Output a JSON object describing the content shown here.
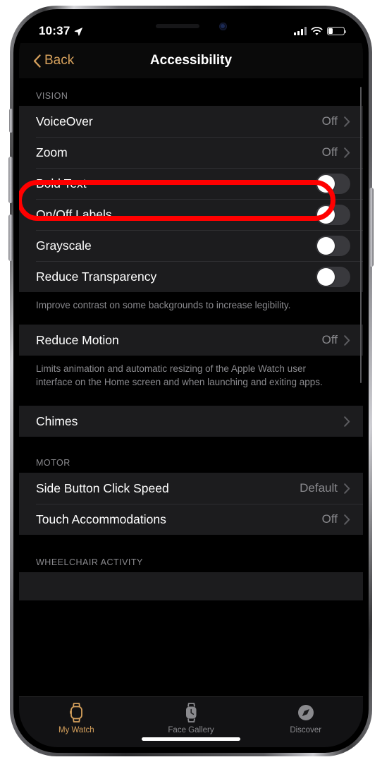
{
  "status_bar": {
    "time": "10:37",
    "location_icon": "location-arrow-icon",
    "cellular_icon": "cellular-signal-icon",
    "wifi_icon": "wifi-icon",
    "battery_icon": "battery-icon"
  },
  "nav_bar": {
    "back_label": "Back",
    "back_icon": "chevron-left-icon",
    "title": "Accessibility",
    "accent_color": "#d5a05c"
  },
  "annotation": {
    "type": "rounded-rect-highlight",
    "target": "Zoom",
    "color": "#ff0000"
  },
  "sections": [
    {
      "header": "VISION",
      "rows": [
        {
          "label": "VoiceOver",
          "value": "Off",
          "type": "disclosure"
        },
        {
          "label": "Zoom",
          "value": "Off",
          "type": "disclosure",
          "highlighted": true
        },
        {
          "label": "Bold Text",
          "type": "toggle",
          "on": false
        },
        {
          "label": "On/Off Labels",
          "type": "toggle",
          "on": false
        },
        {
          "label": "Grayscale",
          "type": "toggle",
          "on": false
        },
        {
          "label": "Reduce Transparency",
          "type": "toggle",
          "on": false
        }
      ],
      "footer": "Improve contrast on some backgrounds to increase legibility."
    },
    {
      "header": "",
      "rows": [
        {
          "label": "Reduce Motion",
          "value": "Off",
          "type": "disclosure"
        }
      ],
      "footer": "Limits animation and automatic resizing of the Apple Watch user interface on the Home screen and when launching and exiting apps."
    },
    {
      "header": "",
      "rows": [
        {
          "label": "Chimes",
          "value": "",
          "type": "disclosure"
        }
      ],
      "footer": ""
    },
    {
      "header": "MOTOR",
      "rows": [
        {
          "label": "Side Button Click Speed",
          "value": "Default",
          "type": "disclosure"
        },
        {
          "label": "Touch Accommodations",
          "value": "Off",
          "type": "disclosure"
        }
      ],
      "footer": ""
    },
    {
      "header": "WHEELCHAIR ACTIVITY",
      "rows": [],
      "footer": ""
    }
  ],
  "tab_bar": {
    "tabs": [
      {
        "label": "My Watch",
        "icon": "watch-icon",
        "active": true
      },
      {
        "label": "Face Gallery",
        "icon": "watch-face-icon",
        "active": false
      },
      {
        "label": "Discover",
        "icon": "compass-icon",
        "active": false
      }
    ]
  }
}
